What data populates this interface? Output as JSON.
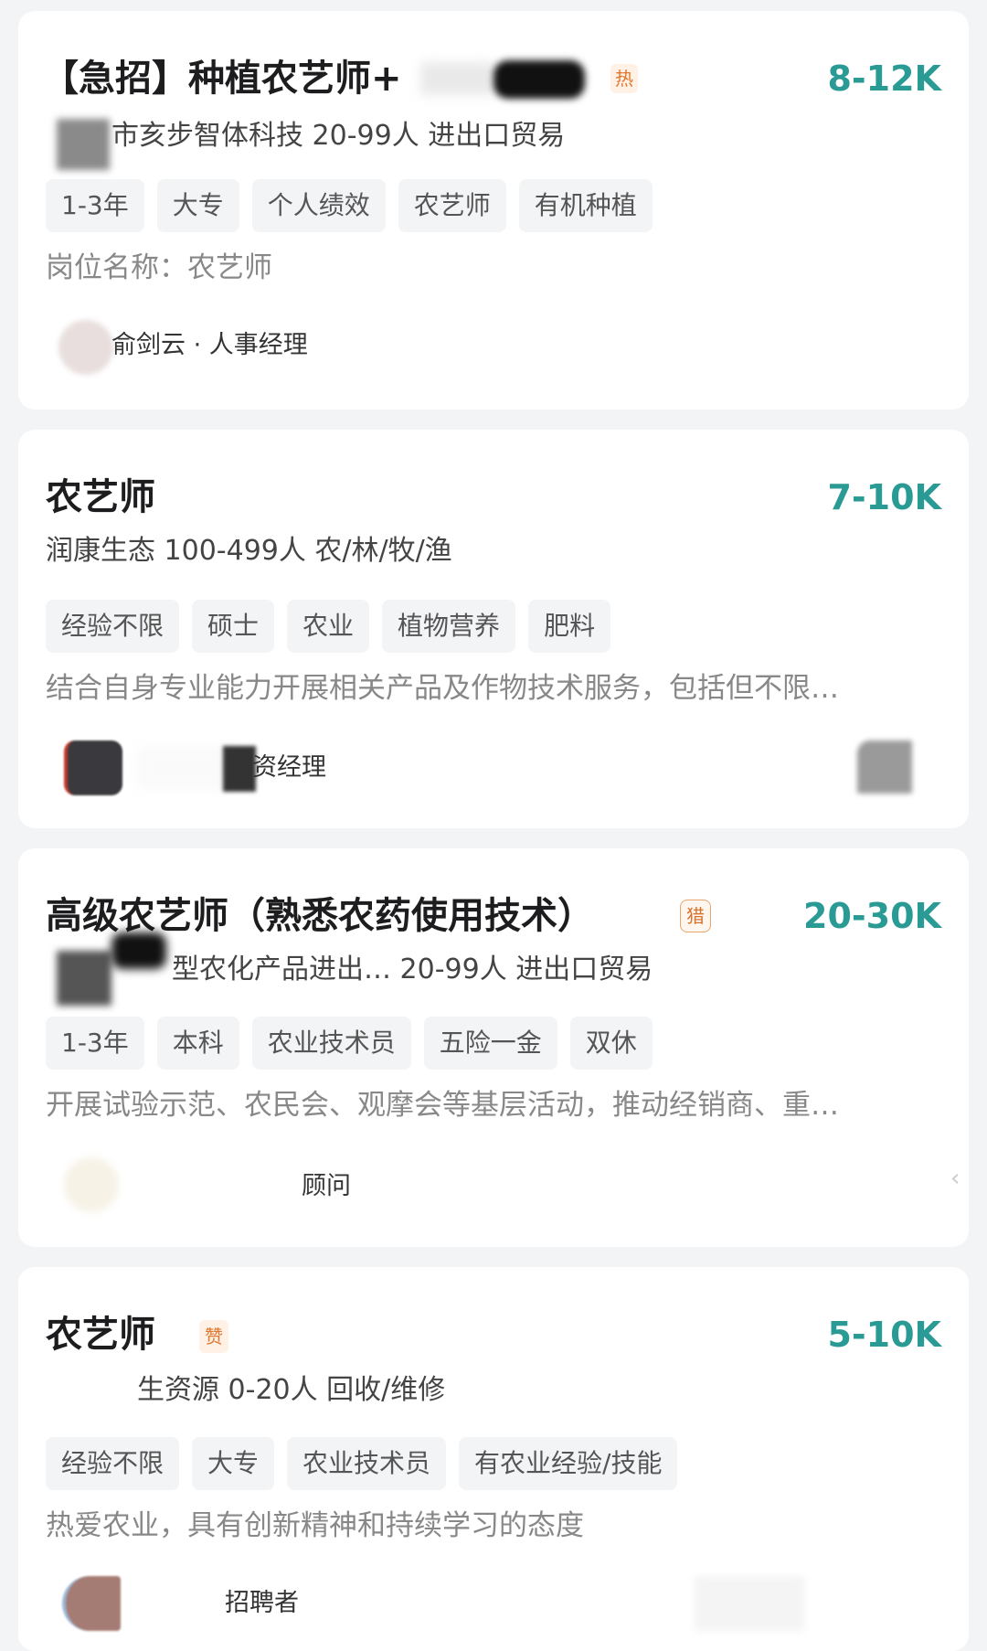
{
  "jobs": [
    {
      "title": "【急招】种植农艺师+",
      "badge": "热",
      "salary": "8-12K",
      "company": "市亥步智体科技 20-99人 进出口贸易",
      "tags": [
        "1-3年",
        "大专",
        "个人绩效",
        "农艺师",
        "有机种植"
      ],
      "description": "岗位名称：农艺师",
      "recruiter": "俞剑云 · 人事经理"
    },
    {
      "title": "农艺师",
      "badge": "",
      "salary": "7-10K",
      "company": "润康生态 100-499人 农/林/牧/渔",
      "tags": [
        "经验不限",
        "硕士",
        "农业",
        "植物营养",
        "肥料"
      ],
      "description": "结合自身专业能力开展相关产品及作物技术服务，包括但不限…",
      "recruiter": "资经理"
    },
    {
      "title": "高级农艺师（熟悉农药使用技术）",
      "badge": "猎",
      "salary": "20-30K",
      "company": "型农化产品进出… 20-99人 进出口贸易",
      "tags": [
        "1-3年",
        "本科",
        "农业技术员",
        "五险一金",
        "双休"
      ],
      "description": "开展试验示范、农民会、观摩会等基层活动，推动经销商、重…",
      "recruiter": "顾问"
    },
    {
      "title": "农艺师",
      "badge": "赞",
      "salary": "5-10K",
      "company": "生资源 0-20人 回收/维修",
      "tags": [
        "经验不限",
        "大专",
        "农业技术员",
        "有农业经验/技能"
      ],
      "description": "热爱农业，具有创新精神和持续学习的态度",
      "recruiter": "招聘者"
    }
  ],
  "icons": {
    "chevron": "chevron-left-icon"
  },
  "colors": {
    "salary": "#2a9a94",
    "badge": "#d9722c",
    "background": "#f3f4f6",
    "card": "#ffffff"
  }
}
